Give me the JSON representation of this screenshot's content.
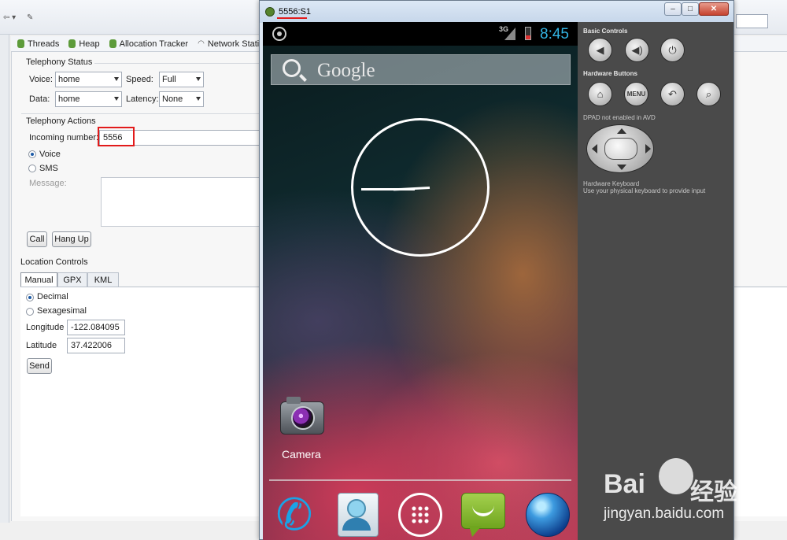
{
  "view_tabs": [
    "Threads",
    "Heap",
    "Allocation Tracker",
    "Network Statistics"
  ],
  "telephony_status": {
    "title": "Telephony Status",
    "voice_label": "Voice:",
    "voice_value": "home",
    "speed_label": "Speed:",
    "speed_value": "Full",
    "data_label": "Data:",
    "data_value": "home",
    "latency_label": "Latency:",
    "latency_value": "None"
  },
  "telephony_actions": {
    "title": "Telephony Actions",
    "incoming_label": "Incoming number:",
    "incoming_value": "5556",
    "voice_radio": "Voice",
    "sms_radio": "SMS",
    "message_label": "Message:",
    "call_button": "Call",
    "hangup_button": "Hang Up"
  },
  "location_controls": {
    "title": "Location Controls",
    "tabs": [
      "Manual",
      "GPX",
      "KML"
    ],
    "decimal_radio": "Decimal",
    "sexagesimal_radio": "Sexagesimal",
    "longitude_label": "Longitude",
    "longitude_value": "-122.084095",
    "latitude_label": "Latitude",
    "latitude_value": "37.422006",
    "send_button": "Send"
  },
  "emulator": {
    "window_title": "5556:S1",
    "status": {
      "network": "3G",
      "time": "8:45"
    },
    "search_brand": "Google",
    "camera_label": "Camera",
    "controls": {
      "basic_title": "Basic Controls",
      "hardware_title": "Hardware Buttons",
      "dpad_title": "DPAD not enabled in AVD",
      "menu_label": "MENU",
      "keyboard_title": "Hardware Keyboard",
      "keyboard_text": "Use your physical keyboard to provide input"
    }
  },
  "watermark": {
    "brand": "Bai",
    "brand2": "经验",
    "url": "jingyan.baidu.com"
  },
  "colors": {
    "accent_time": "#33b5e5",
    "highlight": "#e21b1b"
  }
}
